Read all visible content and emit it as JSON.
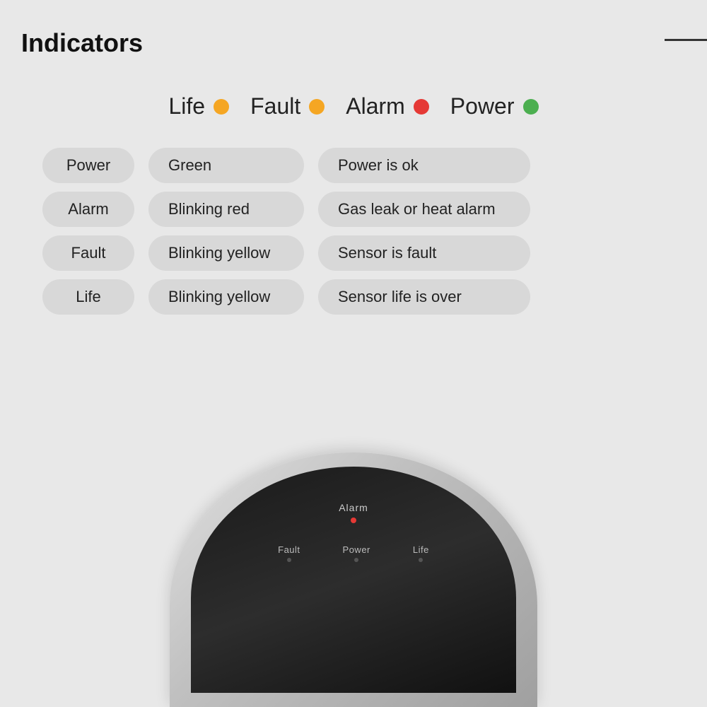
{
  "title": "Indicators",
  "topLine": true,
  "legend": [
    {
      "label": "Life",
      "dotColor": "yellow",
      "dotClass": "dot-yellow"
    },
    {
      "label": "Fault",
      "dotColor": "yellow",
      "dotClass": "dot-yellow"
    },
    {
      "label": "Alarm",
      "dotColor": "red",
      "dotClass": "dot-red"
    },
    {
      "label": "Power",
      "dotColor": "green",
      "dotClass": "dot-green"
    }
  ],
  "tableRows": [
    {
      "col1": "Power",
      "col2": "Green",
      "col3": "Power is ok"
    },
    {
      "col1": "Alarm",
      "col2": "Blinking red",
      "col3": "Gas leak or heat alarm"
    },
    {
      "col1": "Fault",
      "col2": "Blinking yellow",
      "col3": "Sensor is fault"
    },
    {
      "col1": "Life",
      "col2": "Blinking yellow",
      "col3": "Sensor life is over"
    }
  ],
  "device": {
    "alarmLabel": "Alarm",
    "indicators": [
      {
        "label": "Fault"
      },
      {
        "label": "Power"
      },
      {
        "label": "Life"
      }
    ]
  }
}
